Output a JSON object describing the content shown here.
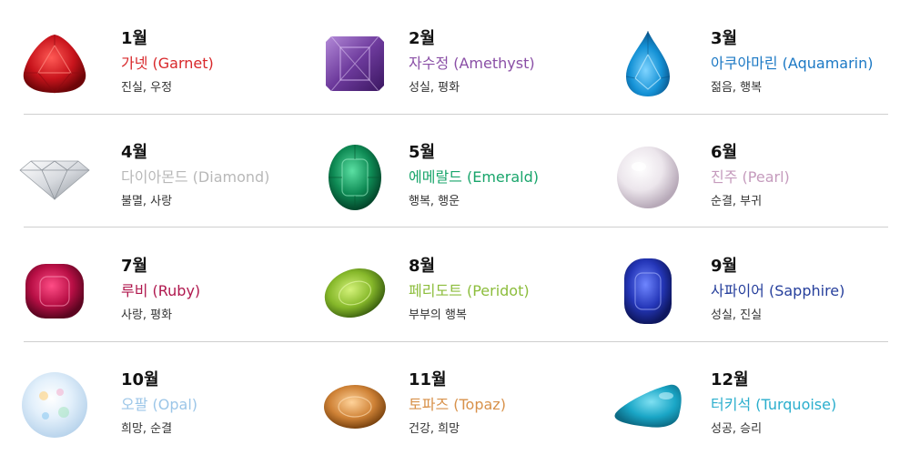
{
  "stones": [
    {
      "month": "1월",
      "name": "가넷 (Garnet)",
      "meaning": "진실, 우정",
      "color": "#d8272a",
      "icon": "garnet-gem-icon"
    },
    {
      "month": "2월",
      "name": "자수정 (Amethyst)",
      "meaning": "성실, 평화",
      "color": "#8a4fa6",
      "icon": "amethyst-gem-icon"
    },
    {
      "month": "3월",
      "name": "아쿠아마린 (Aquamarin)",
      "meaning": "젊음, 행복",
      "color": "#1b78c4",
      "icon": "aquamarine-gem-icon"
    },
    {
      "month": "4월",
      "name": "다이아몬드 (Diamond)",
      "meaning": "불멸, 사랑",
      "color": "#b8b8b8",
      "icon": "diamond-gem-icon"
    },
    {
      "month": "5월",
      "name": "에메랄드 (Emerald)",
      "meaning": "행복, 행운",
      "color": "#19a56b",
      "icon": "emerald-gem-icon"
    },
    {
      "month": "6월",
      "name": "진주 (Pearl)",
      "meaning": "순결, 부귀",
      "color": "#c59bbd",
      "icon": "pearl-gem-icon"
    },
    {
      "month": "7월",
      "name": "루비 (Ruby)",
      "meaning": "사랑, 평화",
      "color": "#b0184e",
      "icon": "ruby-gem-icon"
    },
    {
      "month": "8월",
      "name": "페리도트 (Peridot)",
      "meaning": "부부의 행복",
      "color": "#8cbd3c",
      "icon": "peridot-gem-icon"
    },
    {
      "month": "9월",
      "name": "사파이어 (Sapphire)",
      "meaning": "성실, 진실",
      "color": "#263f9c",
      "icon": "sapphire-gem-icon"
    },
    {
      "month": "10월",
      "name": "오팔 (Opal)",
      "meaning": "희망, 순결",
      "color": "#9cc6e8",
      "icon": "opal-gem-icon"
    },
    {
      "month": "11월",
      "name": "토파즈 (Topaz)",
      "meaning": "건강, 희망",
      "color": "#d8914a",
      "icon": "topaz-gem-icon"
    },
    {
      "month": "12월",
      "name": "터키석 (Turquoise)",
      "meaning": "성공, 승리",
      "color": "#2aaecd",
      "icon": "turquoise-gem-icon"
    }
  ]
}
